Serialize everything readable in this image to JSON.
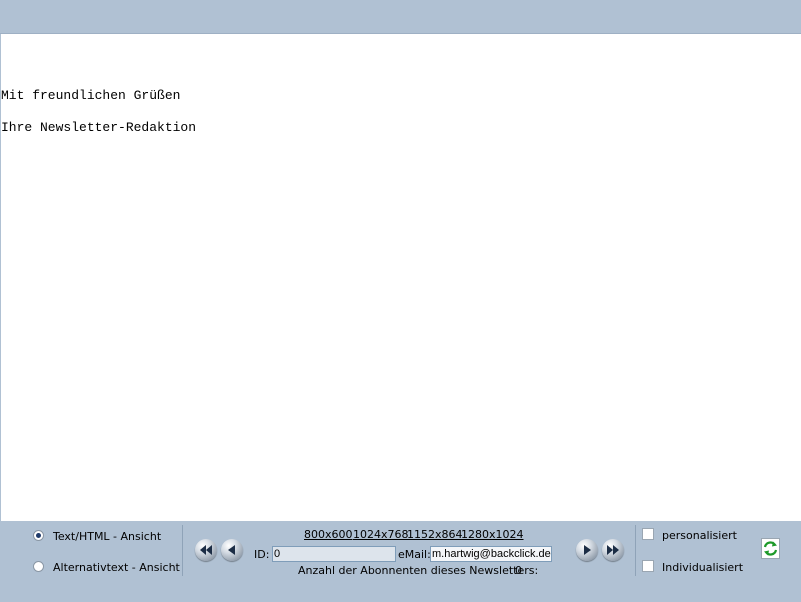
{
  "preview": {
    "lines": [
      "Mit freundlichen Grüßen",
      "Ihre Newsletter-Redaktion"
    ]
  },
  "view_mode": {
    "options": [
      {
        "label": "Text/HTML - Ansicht",
        "checked": true
      },
      {
        "label": "Alternativtext - Ansicht",
        "checked": false
      }
    ]
  },
  "resolutions": [
    "800x600",
    "1024x768",
    "1152x864",
    "1280x1024"
  ],
  "recipient": {
    "id_label": "ID:",
    "id_value": "0",
    "email_label": "eMail:",
    "email_value": "m.hartwig@backclick.de"
  },
  "subscribers": {
    "label": "Anzahl der Abonnenten dieses Newsletters:",
    "count": "0"
  },
  "options": {
    "personalisiert": {
      "label": "personalisiert",
      "checked": false
    },
    "individualisiert": {
      "label": "Individualisiert",
      "checked": false
    }
  },
  "icons": {
    "first": "double-left-arrow-icon",
    "prev": "left-arrow-icon",
    "next": "right-arrow-icon",
    "last": "double-right-arrow-icon",
    "refresh": "refresh-icon"
  },
  "colors": {
    "toolbar": "#b0c1d3",
    "refresh_green": "#1e9a2a"
  }
}
